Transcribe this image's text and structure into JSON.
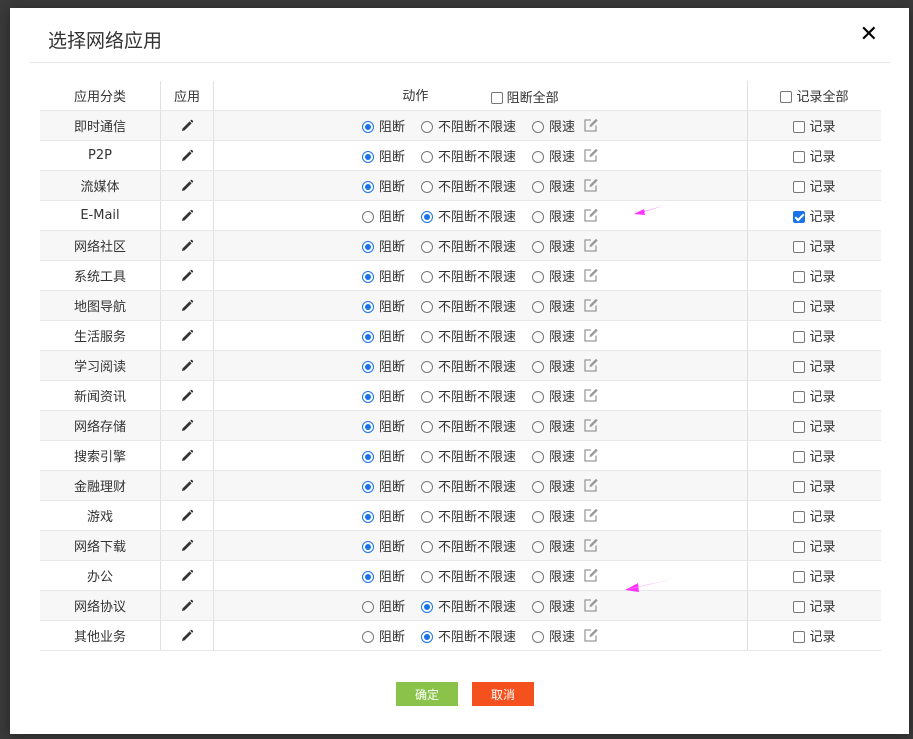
{
  "dialog": {
    "title": "选择网络应用",
    "close_symbol": "✕"
  },
  "table": {
    "headers": {
      "category": "应用分类",
      "app": "应用",
      "action": "动作",
      "block_all": "阻断全部",
      "log_all": "记录全部"
    },
    "options": {
      "block": "阻断",
      "no_block": "不阻断不限速",
      "limit": "限速",
      "log": "记录"
    },
    "rows": [
      {
        "category": "即时通信",
        "action": "block",
        "log": false
      },
      {
        "category": "P2P",
        "action": "block",
        "log": false
      },
      {
        "category": "流媒体",
        "action": "block",
        "log": false
      },
      {
        "category": "E-Mail",
        "action": "no_block",
        "log": true
      },
      {
        "category": "网络社区",
        "action": "block",
        "log": false
      },
      {
        "category": "系统工具",
        "action": "block",
        "log": false
      },
      {
        "category": "地图导航",
        "action": "block",
        "log": false
      },
      {
        "category": "生活服务",
        "action": "block",
        "log": false
      },
      {
        "category": "学习阅读",
        "action": "block",
        "log": false
      },
      {
        "category": "新闻资讯",
        "action": "block",
        "log": false
      },
      {
        "category": "网络存储",
        "action": "block",
        "log": false
      },
      {
        "category": "搜索引擎",
        "action": "block",
        "log": false
      },
      {
        "category": "金融理财",
        "action": "block",
        "log": false
      },
      {
        "category": "游戏",
        "action": "block",
        "log": false
      },
      {
        "category": "网络下载",
        "action": "block",
        "log": false
      },
      {
        "category": "办公",
        "action": "block",
        "log": false
      },
      {
        "category": "网络协议",
        "action": "no_block",
        "log": false
      },
      {
        "category": "其他业务",
        "action": "no_block",
        "log": false
      }
    ]
  },
  "buttons": {
    "ok": "确定",
    "cancel": "取消"
  },
  "colors": {
    "accent": "#1a73e8",
    "ok_button": "#8bc34a",
    "cancel_button": "#f4511e",
    "annotation_arrow": "#ff33ff"
  },
  "icons": {
    "app": "pencil-icon",
    "limit": "edit-square-icon",
    "close": "close-icon"
  }
}
